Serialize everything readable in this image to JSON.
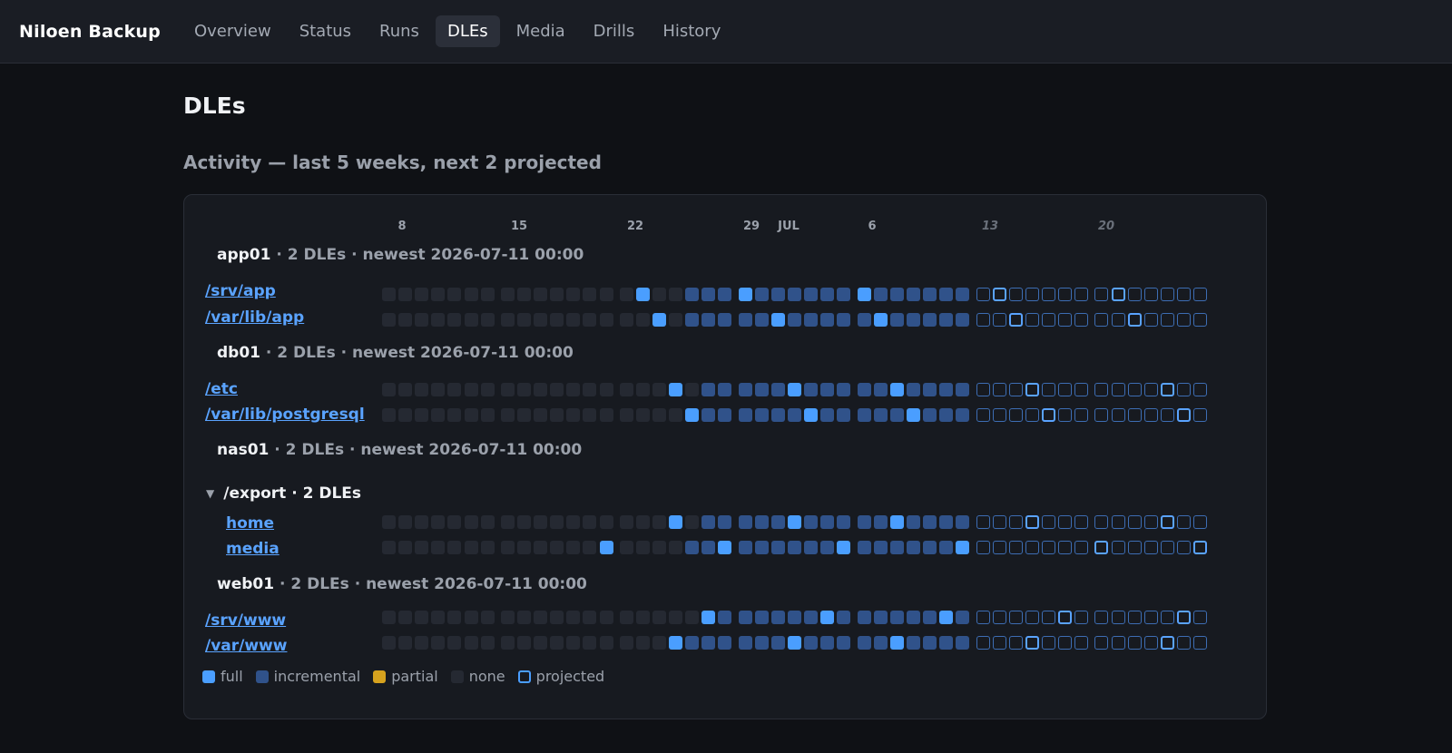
{
  "app": {
    "title": "Niloen Backup"
  },
  "nav": {
    "items": [
      {
        "label": "Overview",
        "active": false
      },
      {
        "label": "Status",
        "active": false
      },
      {
        "label": "Runs",
        "active": false
      },
      {
        "label": "DLEs",
        "active": true
      },
      {
        "label": "Media",
        "active": false
      },
      {
        "label": "Drills",
        "active": false
      },
      {
        "label": "History",
        "active": false
      }
    ]
  },
  "page": {
    "title": "DLEs"
  },
  "activity": {
    "title": "Activity — last 5 weeks, next 2 projected",
    "week_labels": [
      {
        "label": "8",
        "projected": false
      },
      {
        "label": "15",
        "projected": false
      },
      {
        "label": "22",
        "projected": false
      },
      {
        "label": "29",
        "projected": false
      },
      {
        "label": "JUL",
        "projected": false
      },
      {
        "label": "6",
        "projected": false
      },
      {
        "label": "13",
        "projected": true
      },
      {
        "label": "20",
        "projected": true
      }
    ],
    "hosts": [
      {
        "name": "app01",
        "meta": "· 2 DLEs · newest 2026-07-11 00:00"
      },
      {
        "name": "db01",
        "meta": "· 2 DLEs · newest 2026-07-11 00:00"
      },
      {
        "name": "nas01",
        "meta": "· 2 DLEs · newest 2026-07-11 00:00"
      },
      {
        "name": "web01",
        "meta": "· 2 DLEs · newest 2026-07-11 00:00"
      }
    ],
    "group": {
      "label": "/export · 2 DLEs"
    },
    "rows": [
      {
        "label": "/srv/app",
        "cells": "NNNNNNNNNNNNNNNFNNIIIFIIIIIIFIIIIIIPQPPPPPPQPPPPP"
      },
      {
        "label": "/var/lib/app",
        "cells": "NNNNNNNNNNNNNNNNFNIIIIIFIIIIIFIIIIIPPQPPPPPPQPPPP"
      },
      {
        "label": "/etc",
        "cells": "NNNNNNNNNNNNNNNNNFNIIIIIFIIIIIFIIIIPPPQPPPPPPPQPP"
      },
      {
        "label": "/var/lib/postgresql",
        "cells": "NNNNNNNNNNNNNNNNNNFIIIIIIFIIIIIFIIIPPPPQPPPPPPPQP"
      },
      {
        "label": "home",
        "cells": "NNNNNNNNNNNNNNNNNFNIIIIIFIIIIIFIIIIPPPQPPPPPPPQPP"
      },
      {
        "label": "media",
        "cells": "NNNNNNNNNNNNNFNNNNIIFIIIIIIFIIIIIIFPPPPPPPQPPPPPQ"
      },
      {
        "label": "/srv/www",
        "cells": "NNNNNNNNNNNNNNNNNNNFIIIIIIFIIIIIIFIPPPPPQPPPPPPQP"
      },
      {
        "label": "/var/www",
        "cells": "NNNNNNNNNNNNNNNNNFIIIIIIFIIIIIFIIIIPPPQPPPPPPPQPP"
      }
    ],
    "legend": [
      {
        "key": "full",
        "label": "full",
        "color": "#4a9eff"
      },
      {
        "key": "incremental",
        "label": "incremental",
        "color": "#30528a"
      },
      {
        "key": "partial",
        "label": "partial",
        "color": "#d6a21e"
      },
      {
        "key": "none",
        "label": "none",
        "color": "#252932"
      },
      {
        "key": "projected",
        "label": "projected",
        "color": "#4a9eff"
      }
    ]
  }
}
